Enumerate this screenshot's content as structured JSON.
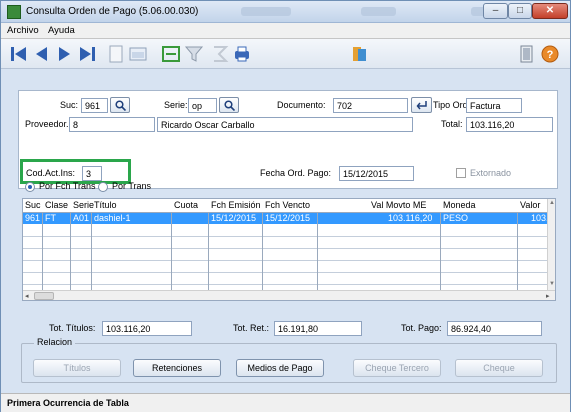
{
  "window": {
    "title": "Consulta Orden de Pago (5.06.00.030)"
  },
  "menu": {
    "archivo": "Archivo",
    "ayuda": "Ayuda"
  },
  "form": {
    "suc_label": "Suc:",
    "suc_value": "961",
    "serie_label": "Serie:",
    "serie_value": "op",
    "documento_label": "Documento:",
    "documento_value": "702",
    "tipo_ord_label": "Tipo Ord:",
    "tipo_ord_value": "Factura",
    "proveedor_label": "Proveedor.:",
    "proveedor_value": "8",
    "proveedor_name": "Ricardo Oscar Carballo",
    "total_label": "Total:",
    "total_value": "103.116,20",
    "cod_act_label": "Cod.Act.Ins:",
    "cod_act_value": "3",
    "fecha_label": "Fecha Ord. Pago:",
    "fecha_value": "15/12/2015",
    "extornado_label": "Extornado"
  },
  "filter": {
    "por_fch_trans": "Por Fch Trans",
    "por_trans": "Por Trans"
  },
  "grid": {
    "headers": [
      "Suc",
      "Clase",
      "Serie",
      "Título",
      "Cuota",
      "Fch Emisión",
      "Fch Vencto",
      "Val Movto ME",
      "Moneda",
      "Valor"
    ],
    "rows": [
      [
        "961",
        "FT",
        "A01",
        "dashiel-1",
        "",
        "15/12/2015",
        "15/12/2015",
        "103.116,20",
        "PESO",
        "103."
      ]
    ]
  },
  "totals": {
    "tot_titulos_label": "Tot. Títulos:",
    "tot_titulos_value": "103.116,20",
    "tot_ret_label": "Tot. Ret.:",
    "tot_ret_value": "16.191,80",
    "tot_pago_label": "Tot. Pago:",
    "tot_pago_value": "86.924,40"
  },
  "relacion": {
    "label": "Relacion",
    "titulos": "Títulos",
    "retenciones": "Retenciones",
    "medios": "Medios de Pago",
    "cheque_tercero": "Cheque Tercero",
    "cheque": "Cheque"
  },
  "status": {
    "text": "Primera Ocurrencia de Tabla"
  },
  "colors": {
    "selection": "#3399ff",
    "highlight_box": "#2aa64b",
    "nav_icon": "#2f5fb0"
  }
}
